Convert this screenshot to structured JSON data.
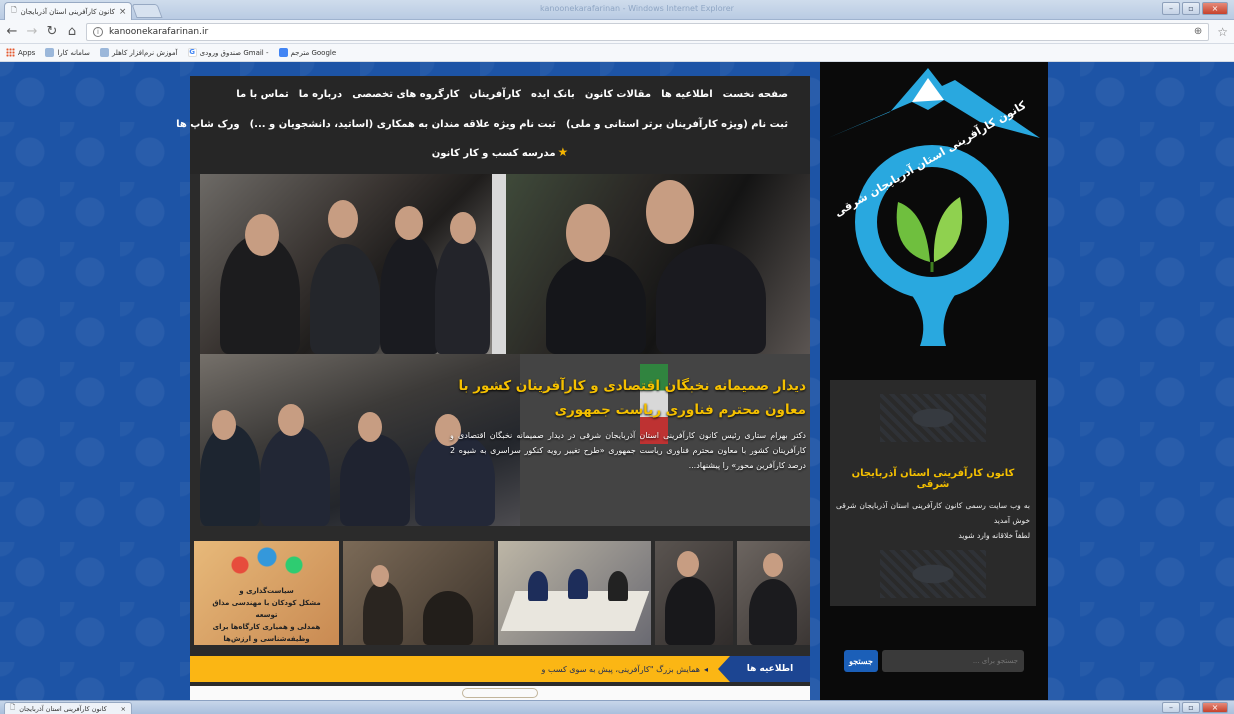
{
  "browser": {
    "tab_title": "کانون کارآفرینی استان آذربایجان",
    "window_title": "kanoonekarafarinan - Windows Internet Explorer",
    "url": "kanoonekarafarinan.ir",
    "bookmarks": [
      {
        "label": "Apps",
        "icon": "apps-grid-icon"
      },
      {
        "label": "سامانه کارا",
        "icon": "page-icon"
      },
      {
        "label": "آموزش نرم‌افزار کاهلر",
        "icon": "page-icon"
      },
      {
        "label": "صندوق ورودی Gmail -",
        "icon": "google-icon"
      },
      {
        "label": "مترجم Google",
        "icon": "translate-icon"
      }
    ]
  },
  "menu": {
    "row1": [
      "صفحه نخست",
      "اطلاعیه ها",
      "مقالات کانون",
      "بانک ایده",
      "کارآفرینان",
      "کارگروه های تخصصی",
      "درباره ما",
      "تماس با ما"
    ],
    "row2": [
      "ثبت نام (ویژه کارآفرینان برتر استانی و ملی)",
      "ثبت نام ویژه علاقه مندان به همکاری (اساتید، دانشجویان و ...)",
      "ورک شاپ ها"
    ],
    "row3": "مدرسه کسب و کار کانون"
  },
  "hero": {
    "title": "دیدار صمیمانه نخبگان اقتصادی و کارآفرینان کشور با معاون محترم فناوری ریاست جمهوری",
    "body": "دکتر بهرام ستاری رئیس کانون کارآفرینی استان آذربایجان شرقی در دیدار صمیمانه نخبگان اقتصادی و کارآفرینان کشور با معاون محترم فناوری ریاست جمهوری «طرح تغییر رویه کنکور سراسری به شیوه 2 درصد کارآفرین محور» را پیشنهاد..."
  },
  "thumb_poster": {
    "line1": "سیاست‌گذاری و",
    "line2": "مشکل کودکان با مهندسی مذاق توسعه",
    "line3": "همدلی و همیاری کارگاه‌ها برای وظیفه‌شناسی و ارزش‌ها"
  },
  "news": {
    "label": "اطلاعیه ها",
    "ticker": "همایش بزرگ \"کارآفرینی، پیش به سوی کسب و"
  },
  "sidebar": {
    "logo_text": "کانون کارآفرینی استان آذربایجان شرقی",
    "info_title": "کانون کارآفرینی استان آذربایجان شرقی",
    "info_text_1": "به وب سایت رسمی کانون کارآفرینی استان آذربایجان شرقی خوش آمدید",
    "info_text_2": "لطفاً خلاقانه وارد شوید",
    "search_button": "جستجو",
    "search_placeholder": "جستجو برای ..."
  },
  "taskbar": {
    "tab_title": "کانون کارآفرینی استان آذربایجان"
  },
  "colors": {
    "accent_yellow": "#f5c000",
    "brand_blue": "#1c4592",
    "news_bar": "#fbb614",
    "background": "#1d54a6"
  }
}
